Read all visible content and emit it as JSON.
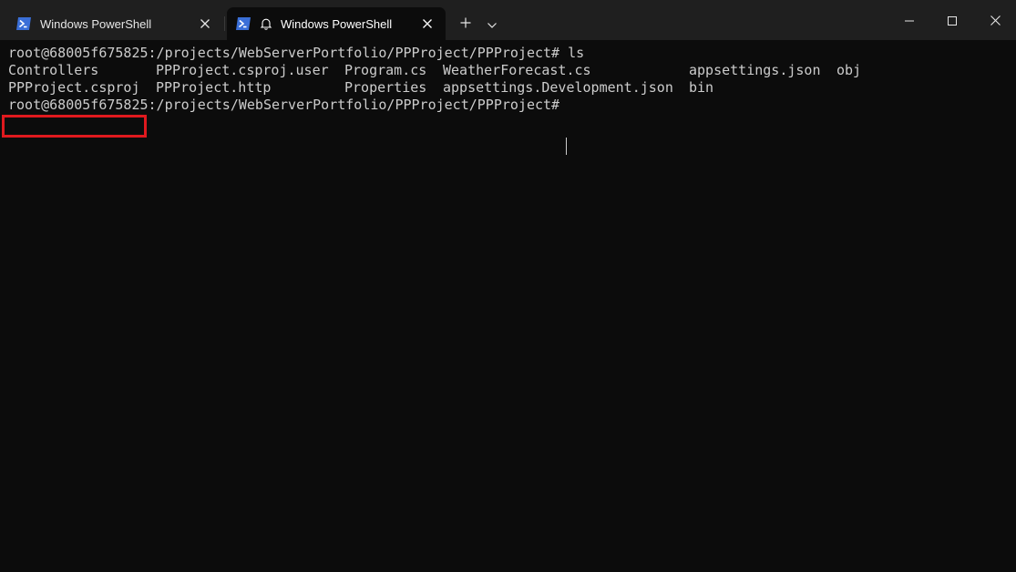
{
  "tabs": [
    {
      "title": "Windows PowerShell",
      "icon": "powershell-icon",
      "active": false
    },
    {
      "title": "Windows PowerShell",
      "icon": "powershell-icon",
      "bell": "bell-icon",
      "active": true
    }
  ],
  "toolbar": {
    "new_tab_icon": "plus-icon",
    "dropdown_icon": "chevron-down-icon"
  },
  "window_controls": [
    "minimize-icon",
    "maximize-icon",
    "close-icon"
  ],
  "terminal": {
    "prompt_line": "root@68005f675825:/projects/WebServerPortfolio/PPProject/PPProject# ls",
    "ls_row1": [
      "Controllers",
      "PPProject.csproj.user",
      "Program.cs",
      "WeatherForecast.cs",
      "appsettings.json",
      "obj"
    ],
    "ls_row2": [
      "PPProject.csproj",
      "PPProject.http",
      "Properties",
      "appsettings.Development.json",
      "bin"
    ],
    "current_prompt": "root@68005f675825:/projects/WebServerPortfolio/PPProject/PPProject#"
  },
  "highlight": {
    "target": "PPProject.csproj",
    "color": "#e0191e"
  },
  "colors": {
    "titlebar": "#1f1f1f",
    "terminal_bg": "#0c0c0c",
    "text": "#cccccc",
    "ps_icon_blue": "#3a6fd8"
  }
}
